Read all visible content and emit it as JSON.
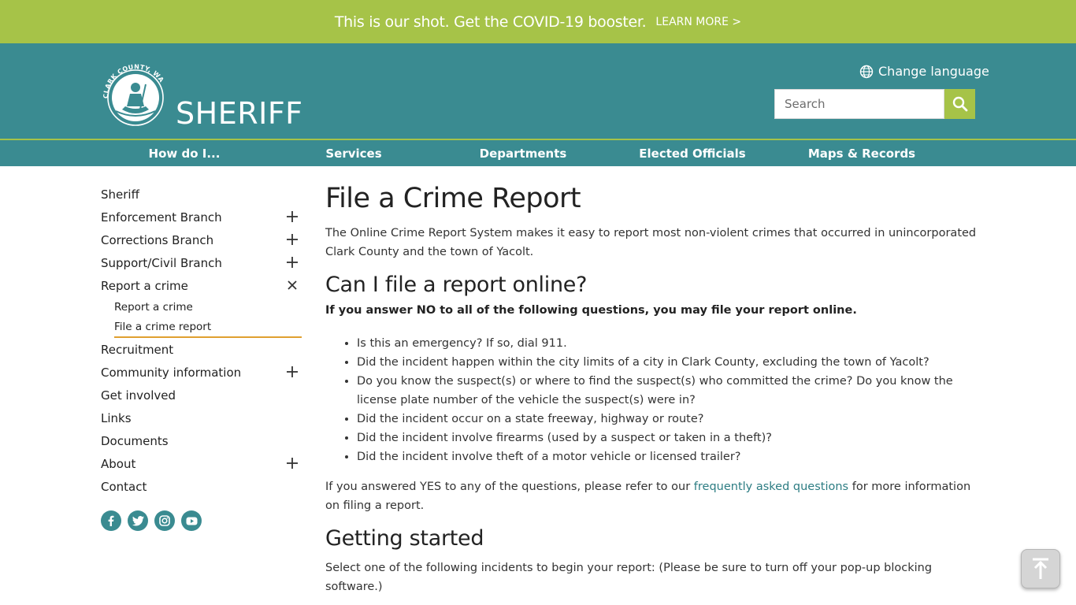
{
  "alert": {
    "message": "This is our shot. Get the COVID-19 booster.",
    "link": "LEARN MORE >"
  },
  "header": {
    "logo_text": "SHERIFF",
    "seal_text": "CLARK COUNTY, WASHINGTON",
    "change_language": "Change language",
    "search_placeholder": "Search"
  },
  "nav": {
    "items": [
      {
        "label": "How do I..."
      },
      {
        "label": "Services"
      },
      {
        "label": "Departments"
      },
      {
        "label": "Elected Officials"
      },
      {
        "label": "Maps & Records"
      }
    ]
  },
  "sidebar": {
    "items": [
      {
        "label": "Sheriff",
        "toggle": "none"
      },
      {
        "label": "Enforcement Branch",
        "toggle": "plus"
      },
      {
        "label": "Corrections Branch",
        "toggle": "plus"
      },
      {
        "label": "Support/Civil Branch",
        "toggle": "plus"
      },
      {
        "label": "Report a crime",
        "toggle": "close"
      },
      {
        "label": "Recruitment",
        "toggle": "none"
      },
      {
        "label": "Community information",
        "toggle": "plus"
      },
      {
        "label": "Get involved",
        "toggle": "none"
      },
      {
        "label": "Links",
        "toggle": "none"
      },
      {
        "label": "Documents",
        "toggle": "none"
      },
      {
        "label": "About",
        "toggle": "plus"
      },
      {
        "label": "Contact",
        "toggle": "none"
      }
    ],
    "subitems": [
      {
        "label": "Report a crime",
        "active": false
      },
      {
        "label": "File a crime report",
        "active": true
      }
    ],
    "social": [
      "facebook-icon",
      "twitter-icon",
      "instagram-icon",
      "youtube-icon"
    ]
  },
  "main": {
    "title": "File a Crime Report",
    "intro": "The Online Crime Report System makes it easy to report most non-violent crimes that occurred in unincorporated Clark County and the town of Yacolt.",
    "heading_online": "Can I file a report online?",
    "bold_line": "If you answer NO to all of the following questions, you may file your report online.",
    "questions": [
      "Is this an emergency? If so, dial 911.",
      "Did the incident happen within the city limits of a city in Clark County, excluding the town of Yacolt?",
      "Do you know the suspect(s) or where to find the suspect(s) who committed the crime? Do you know the license plate number of the vehicle the suspect(s) were in?",
      "Did the incident occur on a state freeway, highway or route?",
      "Did the incident involve firearms (used by a suspect or taken in a theft)?",
      "Did the incident involve theft of a motor vehicle or licensed trailer?"
    ],
    "answer_before": "If you answered YES to any of the questions, please refer to our ",
    "answer_link": "frequently asked questions",
    "answer_after": " for more information on filing a report.",
    "heading_started": "Getting started",
    "select_line": "Select one of the following incidents to begin your report: (Please be sure to turn off your pop-up blocking software.)"
  },
  "colors": {
    "alert_green": "#a6c348",
    "header_teal": "#3a8b91",
    "active_underline": "#e0a030",
    "link": "#2d7d83"
  }
}
